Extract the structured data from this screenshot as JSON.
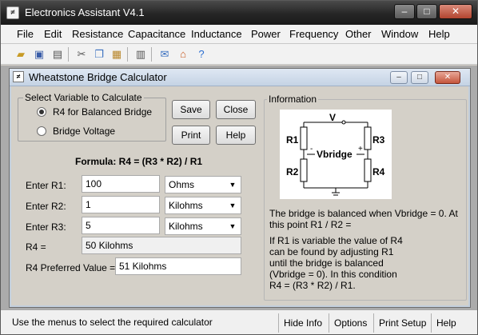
{
  "window": {
    "title": "Electronics Assistant V4.1"
  },
  "menu": [
    "File",
    "Edit",
    "Resistance",
    "Capacitance",
    "Inductance",
    "Power",
    "Frequency",
    "Other",
    "Window",
    "Help"
  ],
  "child": {
    "title": "Wheatstone Bridge Calculator",
    "select_group": "Select Variable to Calculate",
    "radio_r4": "R4 for Balanced Bridge",
    "radio_voltage": "Bridge Voltage",
    "buttons": {
      "save": "Save",
      "close": "Close",
      "print": "Print",
      "help": "Help"
    },
    "formula": "Formula: R4 = (R3 * R2) / R1",
    "r1_label": "Enter R1:",
    "r1_value": "100",
    "r1_unit": "Ohms",
    "r2_label": "Enter R2:",
    "r2_value": "1",
    "r2_unit": "Kilohms",
    "r3_label": "Enter R3:",
    "r3_value": "5",
    "r3_unit": "Kilohms",
    "r4_label": "R4 =",
    "r4_value": "50 Kilohms",
    "r4_pref_label": "R4 Preferred Value =",
    "r4_pref_value": "51 Kilohms",
    "info_group": "Information",
    "diagram": {
      "v": "V",
      "r1": "R1",
      "r2": "R2",
      "r3": "R3",
      "r4": "R4",
      "vbridge": "Vbridge",
      "minus": "-",
      "plus": "+"
    },
    "info_text_1": "The bridge is balanced when Vbridge = 0. At this point R1 / R2 =",
    "info_text_2": "If R1 is variable the value of R4 can be found by adjusting R1 until the bridge is balanced (Vbridge = 0). In this condition R4 = (R3 * R2) / R1."
  },
  "status": {
    "text": "Use the menus to select the required calculator",
    "hide_info": "Hide Info",
    "options": "Options",
    "print_setup": "Print Setup",
    "help": "Help"
  },
  "icons": [
    "open-folder-icon",
    "save-disk-icon",
    "printer-icon",
    "scissors-icon",
    "copy-icon",
    "paste-icon",
    "calculator-icon",
    "mail-icon",
    "home-icon",
    "help-circle-icon"
  ]
}
